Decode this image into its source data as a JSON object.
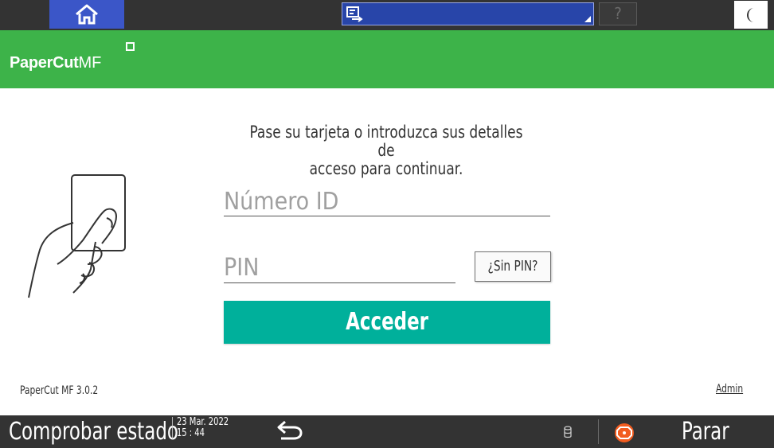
{
  "topbar": {
    "home_icon": "home-icon",
    "app_switch_icon": "app-switch-icon",
    "help_label": "?",
    "sleep_icon": "moon-icon"
  },
  "header": {
    "logo_paper": "PaperCut",
    "logo_mf": "MF",
    "brand_color": "#3db349"
  },
  "login": {
    "prompt_line1": "Pase su tarjeta o introduzca sus detalles de",
    "prompt_line2": "acceso para continuar.",
    "id_placeholder": "Número ID",
    "pin_placeholder": "PIN",
    "no_pin_label": "¿Sin PIN?",
    "login_label": "Acceder",
    "login_color": "#00b09b",
    "illustration_icon": "hand-holding-card-icon"
  },
  "footer": {
    "version": "PaperCut MF 3.0.2",
    "admin_link": "Admin"
  },
  "bottombar": {
    "status_label": "Comprobar estado",
    "date": "23 Mar. 2022",
    "time": "15 : 44",
    "back_icon": "back-arrow-icon",
    "data_icon": "data-indicator-icon",
    "stop_icon": "stop-icon",
    "stop_label": "Parar"
  }
}
